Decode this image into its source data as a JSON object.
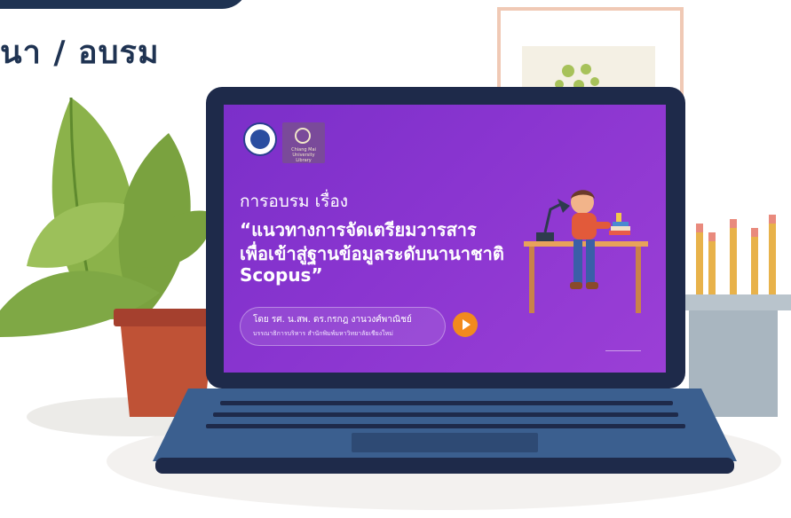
{
  "heading": {
    "text": "นา / อบรม"
  },
  "screen": {
    "logo_caption": "Chiang Mai University Library",
    "subtitle": "การอบรม เรื่อง",
    "title_lines": [
      "“แนวทางการจัดเตรียมวารสาร",
      "เพื่อเข้าสู่ฐานข้อมูลระดับนานาชาติ",
      "Scopus”"
    ],
    "byline": "โดย รศ. น.สพ. ดร.กรกฎ งานวงศ์พาณิชย์",
    "byline_sub": "บรรณาธิการบริหาร สำนักพิมพ์มหาวิทยาลัยเชียงใหม่"
  },
  "colors": {
    "navy": "#1f3352",
    "screen_purple": "#8a35d0",
    "play_orange": "#f28a1e",
    "laptop_frame": "#1e2a4a",
    "keyboard_blue": "#3b5f8f"
  }
}
